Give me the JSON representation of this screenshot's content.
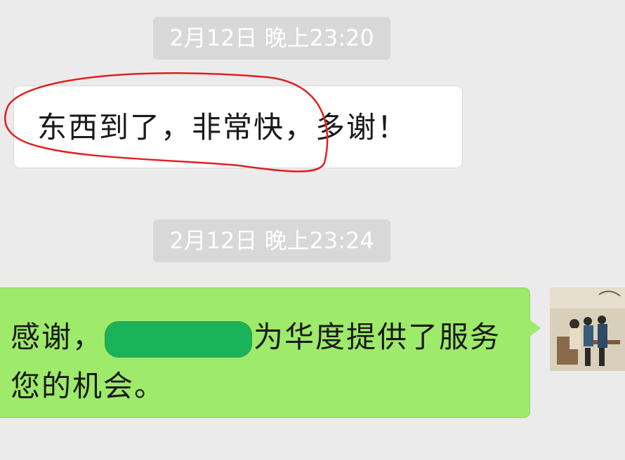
{
  "chat": {
    "timestamps": [
      "2月12日 晚上23:20",
      "2月12日 晚上23:24"
    ],
    "incoming_message": "东西到了，非常快，多谢！",
    "outgoing_message": {
      "line1_before": "感谢，",
      "line1_after": "为华度提供了服务",
      "line2": "您的机会。"
    }
  },
  "colors": {
    "background": "#ebebeb",
    "timestamp_pill": "#d8d8d8",
    "incoming_bubble": "#ffffff",
    "outgoing_bubble": "#9eea6a",
    "annotation_circle": "#e02020",
    "redaction": "#19b45a"
  }
}
